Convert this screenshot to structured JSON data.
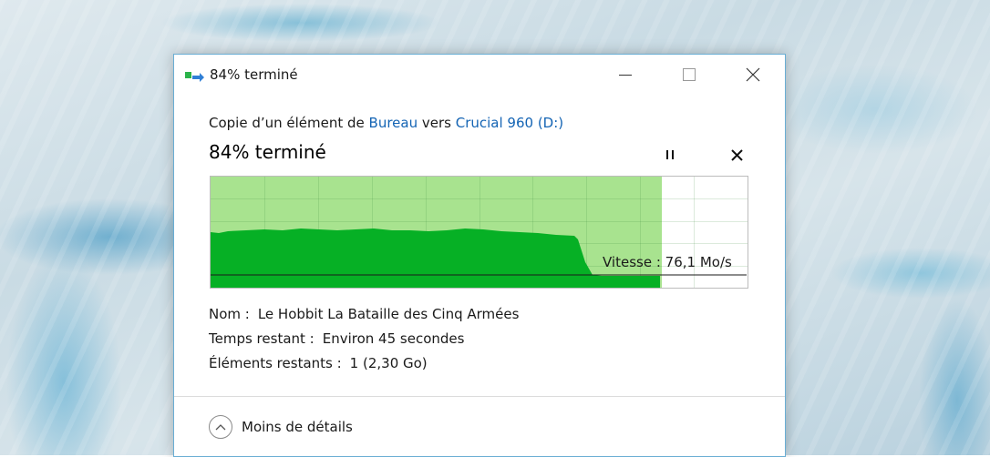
{
  "window": {
    "title": "84% terminé",
    "icon": "copy-transfer-icon",
    "controls": [
      "minimize-icon",
      "maximize-icon",
      "close-icon"
    ]
  },
  "copy": {
    "prefix": "Copie d’un élément de ",
    "source": "Bureau",
    "middle": " vers ",
    "destination": "Crucial 960 (D:)",
    "progress_text": "84% terminé",
    "progress_fraction": 0.84,
    "speed_label": "Vitesse : 76,1 Mo/s"
  },
  "details": {
    "name_label": "Nom :",
    "name_value": "Le Hobbit La Bataille des Cinq Armées",
    "time_label": "Temps restant :",
    "time_value": "Environ 45 secondes",
    "items_label": "Éléments restants :",
    "items_value": "1 (2,30 Go)"
  },
  "footer": {
    "toggle_label": "Moins de détails",
    "toggle_icon": "chevron-up-icon"
  },
  "colors": {
    "progress_fill": "#a8e38f",
    "speed_fill": "#06b025",
    "link": "#1464b4",
    "border": "#6aaed4"
  }
}
